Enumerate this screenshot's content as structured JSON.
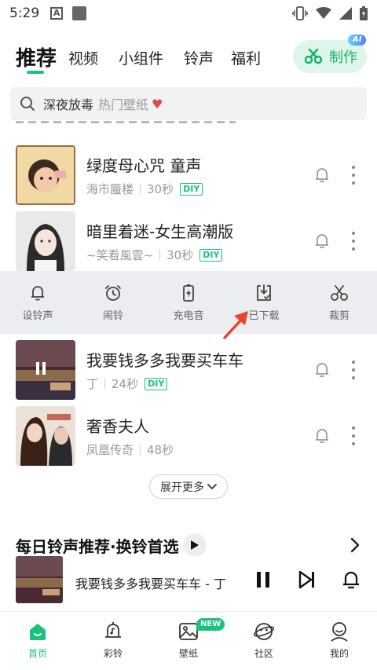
{
  "status_bar": {
    "time": "5:29",
    "notification_letter": "A"
  },
  "tabs": [
    {
      "label": "推荐",
      "active": true
    },
    {
      "label": "视频"
    },
    {
      "label": "小组件"
    },
    {
      "label": "铃声"
    },
    {
      "label": "福利"
    }
  ],
  "make_button": {
    "label": "制作",
    "badge": "AI"
  },
  "search": {
    "query": "深夜放毒",
    "hint": "热门壁纸",
    "emoji": "♥"
  },
  "songs": [
    {
      "title": "绿度母心咒 童声",
      "artist": "海市蜃楼",
      "duration": "30秒",
      "tag": "DIY"
    },
    {
      "title": "暗里着迷-女生高潮版",
      "artist": "~笑看風雲~",
      "duration": "30秒",
      "tag": "DIY"
    },
    {
      "title": "我要钱多多我要买车车",
      "artist": "丁",
      "duration": "24秒",
      "tag": "DIY"
    },
    {
      "title": "奢香夫人",
      "artist": "凤凰传奇",
      "duration": "48秒"
    }
  ],
  "action_bar": [
    {
      "label": "设铃声",
      "icon": "bell-icon"
    },
    {
      "label": "闹铃",
      "icon": "alarm-clock-icon"
    },
    {
      "label": "充电音",
      "icon": "battery-charge-icon"
    },
    {
      "label": "已下载",
      "icon": "downloaded-icon"
    },
    {
      "label": "裁剪",
      "icon": "scissors-icon"
    }
  ],
  "expand_more": "展开更多",
  "section": {
    "title": "每日铃声推荐·换铃首选"
  },
  "player": {
    "title": "我要钱多多我要买车车 - 丁",
    "state": "playing"
  },
  "bottom_nav": [
    {
      "label": "首页",
      "icon": "home-icon",
      "active": true
    },
    {
      "label": "彩铃",
      "icon": "color-ring-icon"
    },
    {
      "label": "壁纸",
      "icon": "wallpaper-icon",
      "badge": "NEW"
    },
    {
      "label": "社区",
      "icon": "community-icon"
    },
    {
      "label": "我的",
      "icon": "profile-icon"
    }
  ],
  "colors": {
    "accent": "#19c37d",
    "action_bg": "#ebedf0",
    "arrow": "#e8452c"
  }
}
